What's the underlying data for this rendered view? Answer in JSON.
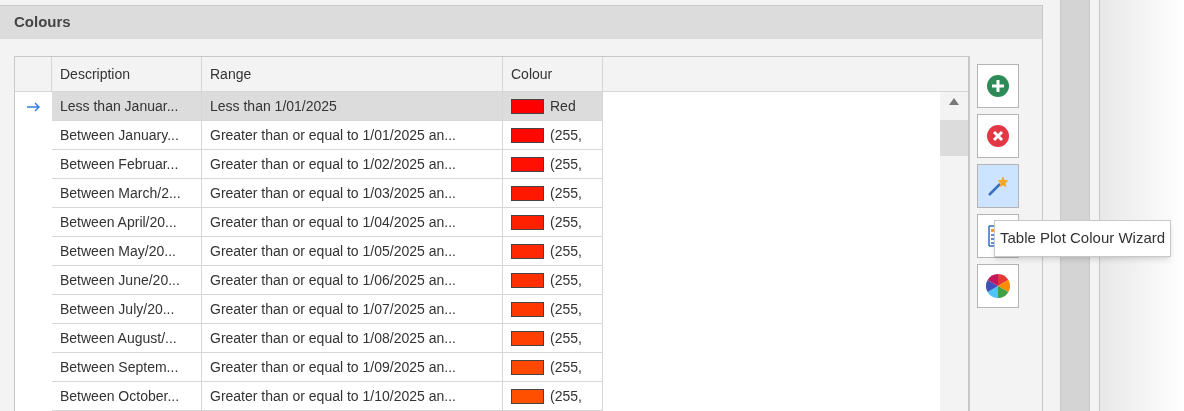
{
  "panel": {
    "title": "Colours"
  },
  "table": {
    "columns": [
      "Description",
      "Range",
      "Colour"
    ],
    "rows": [
      {
        "selected": true,
        "description": "Less than Januar...",
        "range": "Less than 1/01/2025",
        "colour": "Red",
        "color": "#ff0000"
      },
      {
        "selected": false,
        "description": "Between January...",
        "range": "Greater than or equal to 1/01/2025 an...",
        "colour": "(255,",
        "color": "#ff0800"
      },
      {
        "selected": false,
        "description": "Between Februar...",
        "range": "Greater than or equal to 1/02/2025 an...",
        "colour": "(255,",
        "color": "#ff1000"
      },
      {
        "selected": false,
        "description": "Between March/2...",
        "range": "Greater than or equal to 1/03/2025 an...",
        "colour": "(255,",
        "color": "#ff1800"
      },
      {
        "selected": false,
        "description": "Between April/20...",
        "range": "Greater than or equal to 1/04/2025 an...",
        "colour": "(255,",
        "color": "#ff2000"
      },
      {
        "selected": false,
        "description": "Between May/20...",
        "range": "Greater than or equal to 1/05/2025 an...",
        "colour": "(255,",
        "color": "#ff2800"
      },
      {
        "selected": false,
        "description": "Between June/20...",
        "range": "Greater than or equal to 1/06/2025 an...",
        "colour": "(255,",
        "color": "#ff3000"
      },
      {
        "selected": false,
        "description": "Between July/20...",
        "range": "Greater than or equal to 1/07/2025 an...",
        "colour": "(255,",
        "color": "#ff3800"
      },
      {
        "selected": false,
        "description": "Between August/...",
        "range": "Greater than or equal to 1/08/2025 an...",
        "colour": "(255,",
        "color": "#ff4000"
      },
      {
        "selected": false,
        "description": "Between Septem...",
        "range": "Greater than or equal to 1/09/2025 an...",
        "colour": "(255,",
        "color": "#ff4800"
      },
      {
        "selected": false,
        "description": "Between October...",
        "range": "Greater than or equal to 1/10/2025 an...",
        "colour": "(255,",
        "color": "#ff5000"
      }
    ]
  },
  "toolbar": [
    {
      "kind": "add",
      "selected": false
    },
    {
      "kind": "delete",
      "selected": false
    },
    {
      "kind": "wizard",
      "selected": true
    },
    {
      "kind": "table",
      "selected": false
    },
    {
      "kind": "palette",
      "selected": false
    }
  ],
  "tooltip": "Table Plot Colour Wizard"
}
